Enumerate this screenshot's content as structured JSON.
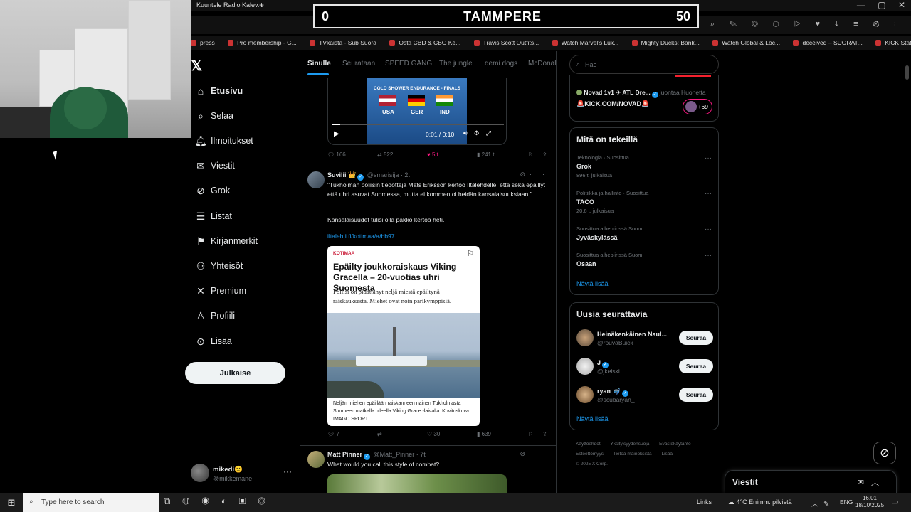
{
  "browser": {
    "tab_title": "Kuuntele Radio Kalev...",
    "new_tab": "+",
    "window_controls": [
      "—",
      "▢",
      "✕"
    ],
    "bookmarks": [
      "press",
      "Pro membership - G...",
      "TVkaista - Sub Suora",
      "Osta CBD & CBG Ke...",
      "Travis Scott Outfits...",
      "Watch Marvel's Luk...",
      "Mighty Ducks: Bank...",
      "Watch Global & Loc...",
      "deceived – SUORAT...",
      "KICK Status Page"
    ]
  },
  "scoreboard": {
    "left_score": "0",
    "title": "TAMMPERE",
    "right_score": "50"
  },
  "nav": {
    "items": [
      {
        "label": "Etusivu",
        "icon": "home-icon"
      },
      {
        "label": "Selaa",
        "icon": "search-icon"
      },
      {
        "label": "Ilmoitukset",
        "icon": "bell-icon"
      },
      {
        "label": "Viestit",
        "icon": "mail-icon"
      },
      {
        "label": "Grok",
        "icon": "grok-icon"
      },
      {
        "label": "Listat",
        "icon": "list-icon"
      },
      {
        "label": "Kirjanmerkit",
        "icon": "bookmark-icon"
      },
      {
        "label": "Yhteisöt",
        "icon": "communities-icon"
      },
      {
        "label": "Premium",
        "icon": "x-icon"
      },
      {
        "label": "Profiili",
        "icon": "person-icon"
      },
      {
        "label": "Lisää",
        "icon": "more-icon"
      }
    ],
    "post_button": "Julkaise",
    "account": {
      "name": "mikedi🙂",
      "handle": "@mikkemane"
    }
  },
  "feed": {
    "tabs": [
      "Sinulle",
      "Seurataan",
      "SPEED GANG",
      "The jungle",
      "demi dogs",
      "McDonal"
    ],
    "video_tweet": {
      "video_title": "COLD SHOWER ENDURANCE - FINALS",
      "flags": [
        "USA",
        "GER",
        "IND"
      ],
      "time": "0:01 / 0:10",
      "replies": "166",
      "reposts": "522",
      "likes": "5 t.",
      "views": "241 t."
    },
    "tweet2": {
      "name": "Suvilii",
      "handle": "@smarisija · 2t",
      "text1": "\"Tukholman poliisin tiedottaja Mats Eriksson kertoo Iltalehdelle, että sekä epäillyt että uhri asuvat Suomessa, mutta ei kommentoi heidän kansalaisuuksiaan.\"",
      "text2": "Kansalaisuudet tulisi olla pakko kertoa heti.",
      "link": "iltalehti.fi/kotimaa/a/bb97...",
      "card_category": "KOTIMAA",
      "card_headline": "Epäilty joukkoraiskaus Viking Gracella – 20-vuotias uhri Suomesta",
      "card_sub": "Poliisi on pidättänyt neljä miestä epäiltynä raiskauksesta. Miehet ovat noin parikymppisiä.",
      "card_caption": "Neljän miehen epäillään raiskanneen nainen Tukholmasta Suomeen matkalla olleella Viking Grace -laivalla. Kuvituskuva. IMAGO SPORT",
      "replies": "7",
      "reposts": "",
      "likes": "30",
      "views": "639"
    },
    "tweet3": {
      "name": "Matt Pinner",
      "handle": "@Matt_Pinner · 7t",
      "text": "What would you call this style of combat?"
    }
  },
  "right": {
    "search_placeholder": "Hae",
    "live": {
      "line1_name": "Novad 1v1 ✈ ATL Dre...",
      "line1_meta": "juontaa Huonetta",
      "line2": "🚨KICK.COM/NOVAD🚨",
      "badge": "+69"
    },
    "trends_title": "Mitä on tekeillä",
    "trends": [
      {
        "meta": "Teknologia · Suosittua",
        "name": "Grok",
        "count": "896 t. julkaisua"
      },
      {
        "meta": "Politiikka ja hallinto · Suosittua",
        "name": "TACO",
        "count": "20,6 t. julkaisua"
      },
      {
        "meta": "Suosittua aihepiirissä Suomi",
        "name": "Jyväskylässä",
        "count": ""
      },
      {
        "meta": "Suosittua aihepiirissä Suomi",
        "name": "Osaan",
        "count": ""
      }
    ],
    "show_more": "Näytä lisää",
    "follow_title": "Uusia seurattavia",
    "follows": [
      {
        "name": "Heinäkenkäinen Naul...",
        "handle": "@rouvaBuick",
        "button": "Seuraa"
      },
      {
        "name": "J",
        "handle": "@jkeiski",
        "button": "Seuraa"
      },
      {
        "name": "ryan 🤿",
        "handle": "@scubaryan_",
        "button": "Seuraa"
      }
    ],
    "follow_more": "Näytä lisää",
    "footer": [
      "Käyttöehdot",
      "Yksityisyydensuoja",
      "Evästekäytäntö",
      "Esteettömyys",
      "Tietoa mainoksista",
      "Lisää ···",
      "© 2025 X Corp."
    ],
    "messages_dock": "Viestit"
  },
  "taskbar": {
    "search_placeholder": "Type here to search",
    "links": "Links",
    "weather": "4°C  Enimm. pilvistä",
    "lang": "ENG",
    "time": "16.01",
    "date": "18/10/2025"
  },
  "colors": {
    "accent": "#1d9bf0",
    "like": "#f91880",
    "bg": "#000000"
  }
}
